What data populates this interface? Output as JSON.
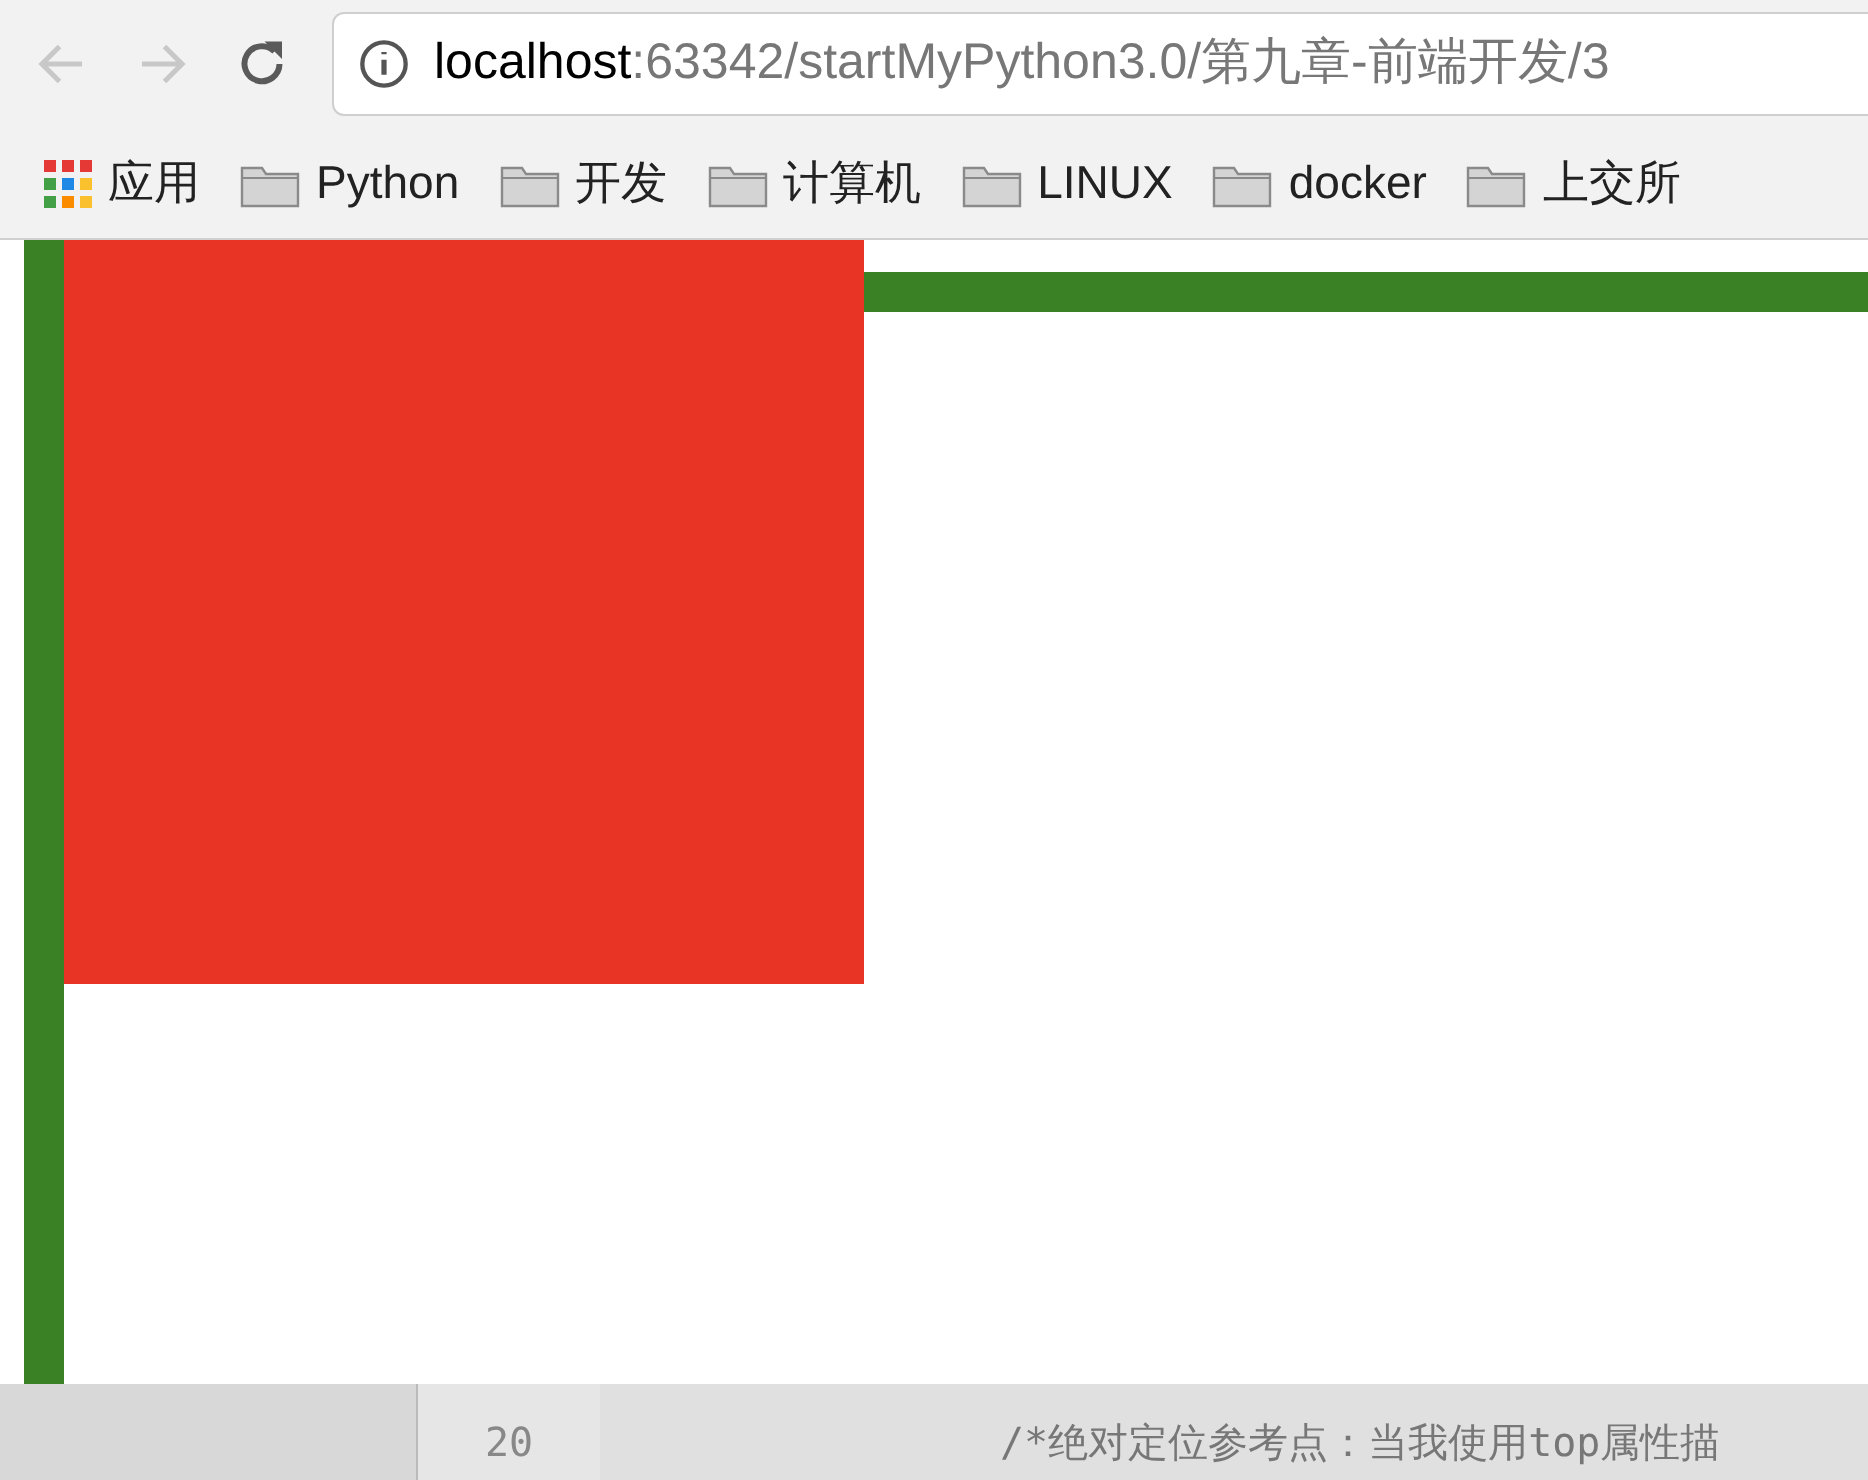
{
  "toolbar": {
    "url_host": "localhost",
    "url_path": ":63342/startMyPython3.0/第九章-前端开发/3"
  },
  "bookmarks": [
    {
      "kind": "apps",
      "label": "应用"
    },
    {
      "kind": "folder",
      "label": "Python"
    },
    {
      "kind": "folder",
      "label": "开发"
    },
    {
      "kind": "folder",
      "label": "计算机"
    },
    {
      "kind": "folder",
      "label": "LINUX"
    },
    {
      "kind": "folder",
      "label": "docker"
    },
    {
      "kind": "folder",
      "label": "上交所"
    }
  ],
  "editor": {
    "line_number": "20",
    "code_line": "/*绝对定位参考点：当我使用top属性描"
  }
}
